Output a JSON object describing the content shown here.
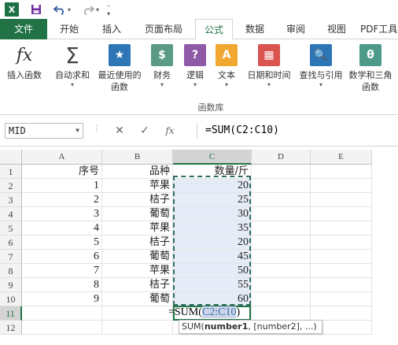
{
  "quick_access": {
    "save_icon": "save-icon",
    "undo_icon": "undo-icon",
    "redo_icon": "redo-icon",
    "logo": "X"
  },
  "tabs": [
    {
      "label": "文件"
    },
    {
      "label": "开始"
    },
    {
      "label": "插入"
    },
    {
      "label": "页面布局"
    },
    {
      "label": "公式"
    },
    {
      "label": "数据"
    },
    {
      "label": "审阅"
    },
    {
      "label": "视图"
    },
    {
      "label": "PDF工具"
    }
  ],
  "ribbon": {
    "buttons": [
      {
        "label": "插入函数",
        "icon": "fx"
      },
      {
        "label": "自动求和",
        "icon": "Σ"
      },
      {
        "label": "最近使用的函数",
        "icon": "★"
      },
      {
        "label": "财务",
        "icon": "$"
      },
      {
        "label": "逻辑",
        "icon": "?"
      },
      {
        "label": "文本",
        "icon": "A"
      },
      {
        "label": "日期和时间",
        "icon": "▦"
      },
      {
        "label": "查找与引用",
        "icon": "🔍"
      },
      {
        "label": "数学和三角函数",
        "icon": "θ"
      }
    ],
    "group_label": "函数库"
  },
  "formula_bar": {
    "name_box": "MID",
    "cancel": "✕",
    "enter": "✓",
    "fx": "fx",
    "formula": "=SUM(C2:C10)"
  },
  "grid": {
    "columns": [
      "A",
      "B",
      "C",
      "D",
      "E"
    ],
    "rows": [
      "1",
      "2",
      "3",
      "4",
      "5",
      "6",
      "7",
      "8",
      "9",
      "10",
      "11",
      "12"
    ],
    "header": {
      "a": "序号",
      "b": "品种",
      "c": "数量/斤"
    },
    "data": [
      {
        "a": "1",
        "b": "苹果",
        "c": "20"
      },
      {
        "a": "2",
        "b": "桔子",
        "c": "25"
      },
      {
        "a": "3",
        "b": "葡萄",
        "c": "30"
      },
      {
        "a": "4",
        "b": "苹果",
        "c": "35"
      },
      {
        "a": "5",
        "b": "桔子",
        "c": "20"
      },
      {
        "a": "6",
        "b": "葡萄",
        "c": "45"
      },
      {
        "a": "7",
        "b": "苹果",
        "c": "50"
      },
      {
        "a": "8",
        "b": "桔子",
        "c": "55"
      },
      {
        "a": "9",
        "b": "葡萄",
        "c": "60"
      }
    ],
    "edit": {
      "prefix": "=SUM(",
      "ref": "C2:C10",
      "suffix": ")"
    },
    "tooltip": {
      "fn": "SUM(",
      "arg1": "number1",
      "rest": ", [number2], ...)"
    }
  }
}
